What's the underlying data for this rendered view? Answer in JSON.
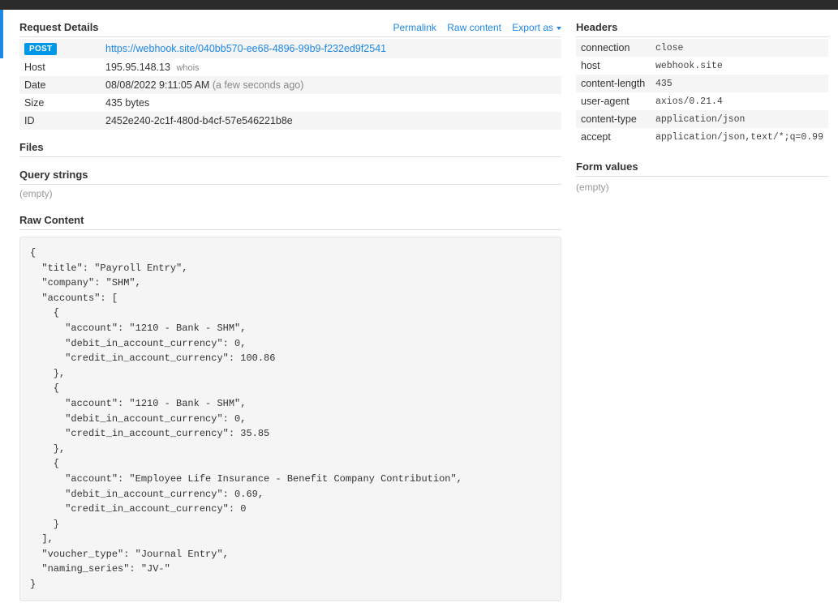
{
  "topActions": {
    "permalink": "Permalink",
    "rawContent": "Raw content",
    "exportAs": "Export as"
  },
  "requestDetails": {
    "title": "Request Details",
    "method": "POST",
    "url": "https://webhook.site/040bb570-ee68-4896-99b9-f232ed9f2541",
    "rows": {
      "hostLabel": "Host",
      "hostValue": "195.95.148.13",
      "whois": "whois",
      "dateLabel": "Date",
      "dateValue": "08/08/2022 9:11:05 AM",
      "dateNote": "(a few seconds ago)",
      "sizeLabel": "Size",
      "sizeValue": "435 bytes",
      "idLabel": "ID",
      "idValue": "2452e240-2c1f-480d-b4cf-57e546221b8e"
    }
  },
  "files": {
    "title": "Files"
  },
  "queryStrings": {
    "title": "Query strings",
    "empty": "(empty)"
  },
  "rawContent": {
    "title": "Raw Content",
    "body": "{\n  \"title\": \"Payroll Entry\",\n  \"company\": \"SHM\",\n  \"accounts\": [\n    {\n      \"account\": \"1210 - Bank - SHM\",\n      \"debit_in_account_currency\": 0,\n      \"credit_in_account_currency\": 100.86\n    },\n    {\n      \"account\": \"1210 - Bank - SHM\",\n      \"debit_in_account_currency\": 0,\n      \"credit_in_account_currency\": 35.85\n    },\n    {\n      \"account\": \"Employee Life Insurance - Benefit Company Contribution\",\n      \"debit_in_account_currency\": 0.69,\n      \"credit_in_account_currency\": 0\n    }\n  ],\n  \"voucher_type\": \"Journal Entry\",\n  \"naming_series\": \"JV-\"\n}"
  },
  "headers": {
    "title": "Headers",
    "rows": [
      {
        "k": "connection",
        "v": "close"
      },
      {
        "k": "host",
        "v": "webhook.site"
      },
      {
        "k": "content-length",
        "v": "435"
      },
      {
        "k": "user-agent",
        "v": "axios/0.21.4"
      },
      {
        "k": "content-type",
        "v": "application/json"
      },
      {
        "k": "accept",
        "v": "application/json,text/*;q=0.99"
      }
    ]
  },
  "formValues": {
    "title": "Form values",
    "empty": "(empty)"
  }
}
